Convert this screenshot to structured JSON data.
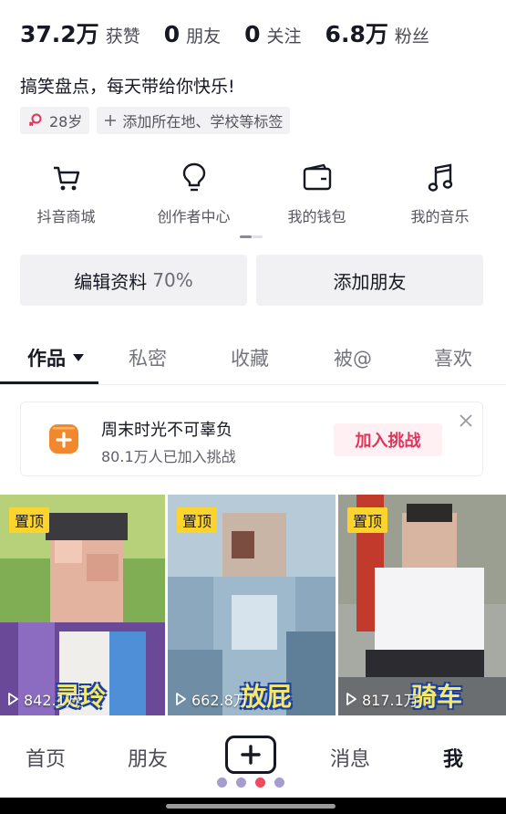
{
  "stats": [
    {
      "value": "37.2万",
      "label": "获赞"
    },
    {
      "value": "0",
      "label": "朋友"
    },
    {
      "value": "0",
      "label": "关注"
    },
    {
      "value": "6.8万",
      "label": "粉丝"
    }
  ],
  "bio": "搞笑盘点，每天带给你快乐!",
  "tags": {
    "age": "28岁",
    "gender_icon": "female-icon",
    "add_label": "添加所在地、学校等标签"
  },
  "services": [
    {
      "label": "抖音商城",
      "icon": "cart-icon"
    },
    {
      "label": "创作者中心",
      "icon": "lightbulb-icon"
    },
    {
      "label": "我的钱包",
      "icon": "wallet-icon"
    },
    {
      "label": "我的音乐",
      "icon": "music-note-icon"
    }
  ],
  "actions": {
    "edit_label": "编辑资料",
    "edit_percent": "70%",
    "add_friend_label": "添加朋友"
  },
  "tabs": [
    "作品",
    "私密",
    "收藏",
    "被@",
    "喜欢"
  ],
  "active_tab": "作品",
  "challenge": {
    "title": "周末时光不可辜负",
    "subtitle": "80.1万人已加入挑战",
    "button": "加入挑战"
  },
  "videos": [
    {
      "pinned_label": "置顶",
      "views": "842.1万",
      "caption": "灵玲"
    },
    {
      "pinned_label": "置顶",
      "views": "662.8万",
      "caption": "放屁"
    },
    {
      "pinned_label": "置顶",
      "views": "817.1万",
      "caption": "骑车"
    }
  ],
  "bottom_nav": {
    "home": "首页",
    "friends": "朋友",
    "create_icon": "plus-icon",
    "messages": "消息",
    "me": "我"
  },
  "colors": {
    "text_primary": "#161823",
    "accent_red": "#e0345b",
    "pin_yellow": "#fcd42d",
    "challenge_orange": "#f2882e"
  }
}
